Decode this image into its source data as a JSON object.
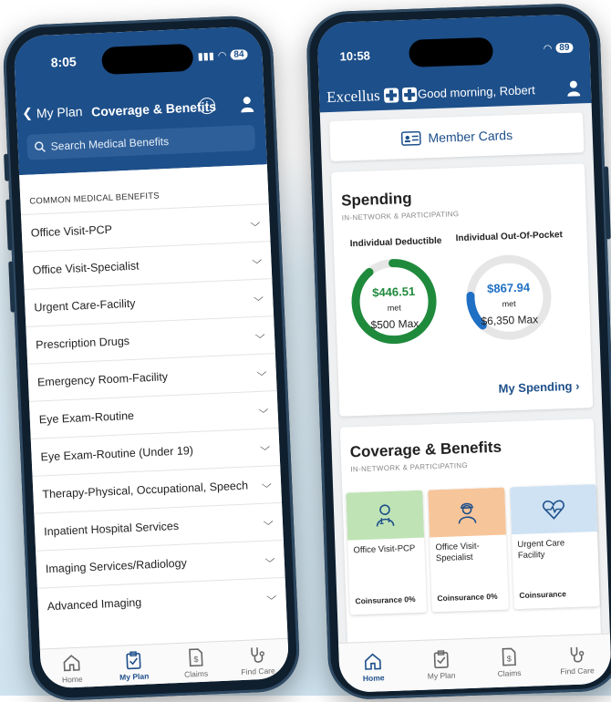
{
  "left_phone": {
    "status": {
      "time": "8:05",
      "battery": "84"
    },
    "nav": {
      "back_label": "My Plan",
      "title": "Coverage & Benefits"
    },
    "search": {
      "placeholder": "Search Medical Benefits"
    },
    "section_label": "COMMON MEDICAL BENEFITS",
    "benefits": [
      "Office Visit-PCP",
      "Office Visit-Specialist",
      "Urgent Care-Facility",
      "Prescription Drugs",
      "Emergency Room-Facility",
      "Eye Exam-Routine",
      "Eye Exam-Routine (Under 19)",
      "Therapy-Physical, Occupational, Speech",
      "Inpatient Hospital Services",
      "Imaging Services/Radiology",
      "Advanced Imaging"
    ],
    "tabs": [
      "Home",
      "My Plan",
      "Claims",
      "Find Care"
    ]
  },
  "right_phone": {
    "status": {
      "time": "10:58",
      "battery": "89"
    },
    "brand": "Excellus",
    "greeting": "Good morning, Robert",
    "member_cards_label": "Member Cards",
    "spending": {
      "title": "Spending",
      "subtitle": "IN-NETWORK & PARTICIPATING",
      "deductible": {
        "label": "Individual Deductible",
        "amount": "$446.51",
        "met": "met",
        "max": "$500 Max",
        "fraction": 0.893,
        "color": "#1f8a3c"
      },
      "oop": {
        "label": "Individual Out-Of-Pocket",
        "amount": "$867.94",
        "met": "met",
        "max": "$6,350 Max",
        "fraction": 0.137,
        "color": "#1f6fc4"
      },
      "link": "My Spending ›"
    },
    "coverage": {
      "title": "Coverage & Benefits",
      "subtitle": "IN-NETWORK & PARTICIPATING",
      "tiles": [
        {
          "name": "Office Visit-PCP",
          "coinsurance": "Coinsurance 0%",
          "color": "#bfe3b5",
          "icon": "doctor-icon"
        },
        {
          "name": "Office Visit-Specialist",
          "coinsurance": "Coinsurance 0%",
          "color": "#f7c59a",
          "icon": "specialist-icon"
        },
        {
          "name": "Urgent Care Facility",
          "coinsurance": "Coinsurance",
          "color": "#cfe2f3",
          "icon": "heart-pulse-icon"
        }
      ]
    },
    "tabs": [
      "Home",
      "My Plan",
      "Claims",
      "Find Care"
    ]
  }
}
